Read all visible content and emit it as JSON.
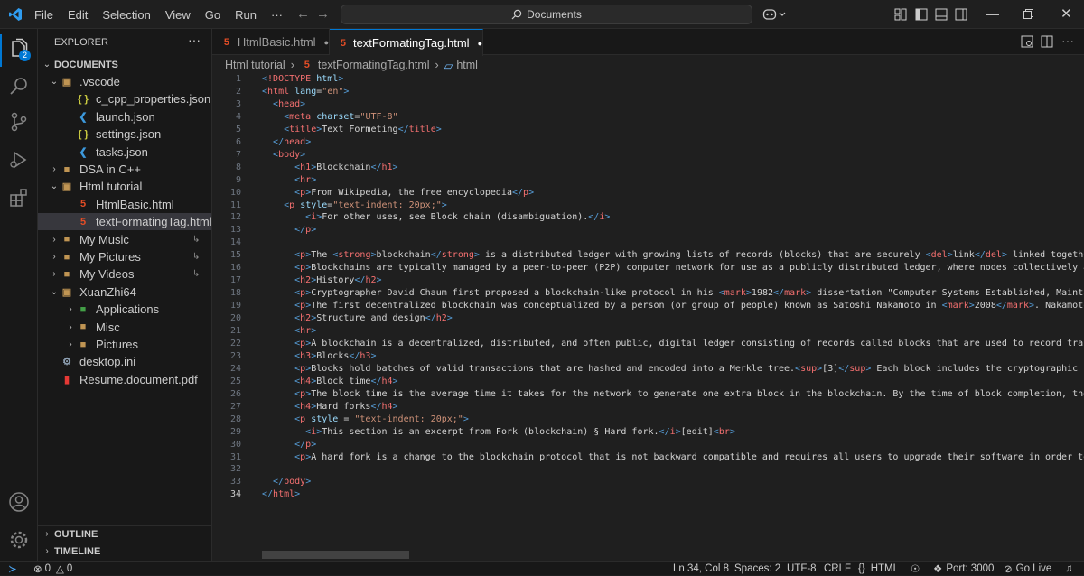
{
  "menu": [
    "File",
    "Edit",
    "Selection",
    "View",
    "Go",
    "Run",
    "···"
  ],
  "search": {
    "label": "Documents"
  },
  "activity": {
    "badge": "2"
  },
  "explorer": {
    "title": "EXPLORER",
    "root": "DOCUMENTS",
    "items": [
      {
        "label": ".vscode",
        "indent": 1,
        "type": "folder-open",
        "icon": "vscode-folder-icon"
      },
      {
        "label": "c_cpp_properties.json",
        "indent": 2,
        "type": "json"
      },
      {
        "label": "launch.json",
        "indent": 2,
        "type": "vscode"
      },
      {
        "label": "settings.json",
        "indent": 2,
        "type": "json"
      },
      {
        "label": "tasks.json",
        "indent": 2,
        "type": "vscode"
      },
      {
        "label": "DSA in C++",
        "indent": 1,
        "type": "folder-closed"
      },
      {
        "label": "Html tutorial",
        "indent": 1,
        "type": "folder-open"
      },
      {
        "label": "HtmlBasic.html",
        "indent": 2,
        "type": "html"
      },
      {
        "label": "textFormatingTag.html",
        "indent": 2,
        "type": "html",
        "selected": true
      },
      {
        "label": "My Music",
        "indent": 1,
        "type": "folder-link"
      },
      {
        "label": "My Pictures",
        "indent": 1,
        "type": "folder-link"
      },
      {
        "label": "My Videos",
        "indent": 1,
        "type": "folder-link"
      },
      {
        "label": "XuanZhi64",
        "indent": 1,
        "type": "folder-open"
      },
      {
        "label": "Applications",
        "indent": 2,
        "type": "folder-app"
      },
      {
        "label": "Misc",
        "indent": 2,
        "type": "folder-closed"
      },
      {
        "label": "Pictures",
        "indent": 2,
        "type": "folder-closed"
      },
      {
        "label": "desktop.ini",
        "indent": 1,
        "type": "gear"
      },
      {
        "label": "Resume.document.pdf",
        "indent": 1,
        "type": "pdf"
      }
    ],
    "outline": "OUTLINE",
    "timeline": "TIMELINE"
  },
  "tabs": [
    {
      "label": "HtmlBasic.html",
      "active": false
    },
    {
      "label": "textFormatingTag.html",
      "active": true
    }
  ],
  "breadcrumb": {
    "folder": "Html tutorial",
    "file": "textFormatingTag.html",
    "symbol": "html"
  },
  "code": [
    "<!DOCTYPE html>",
    "<html lang=\"en\">",
    "  <head>",
    "    <meta charset=\"UTF-8\"",
    "    <title>Text Formeting</title>",
    "  </head>",
    "  <body>",
    "      <h1>Blockchain</h1>",
    "      <hr>",
    "      <p>From Wikipedia, the free encyclopedia</p>",
    "    <p style=\"text-indent: 20px;\">",
    "        <i>For other uses, see Block chain (disambiguation).</i>",
    "      </p>",
    "",
    "      <p>The <strong>blockchain</strong> is a distributed ledger with growing lists of records (blocks) that are securely <del>link</del> linked together via c",
    "      <p>Blockchains are typically managed by a peer-to-peer (P2P) computer network for use as a publicly distributed ledger, where nodes collectively adhere to",
    "      <h2>History</h2>",
    "      <p>Cryptographer David Chaum first proposed a blockchain-like protocol in his <mark>1982</mark> dissertation \"Computer Systems Established, Maintained,",
    "      <p>The first decentralized blockchain was conceptualized by a person (or group of people) known as Satoshi Nakamoto in <mark>2008</mark>. Nakamoto improv",
    "      <h2>Structure and design</h2>",
    "      <hr>",
    "      <p>A blockchain is a decentralized, distributed, and often public, digital ledger consisting of records called blocks that are used to record transaction",
    "      <h3>Blocks</h3>",
    "      <p>Blocks hold batches of valid transactions that are hashed and encoded into a Merkle tree.<sup>[3]</sup> Each block includes the cryptographic hash of",
    "      <h4>Block time</h4>",
    "      <p>The block time is the average time it takes for the network to generate one extra block in the blockchain. By the time of block completion, the inclu",
    "      <h4>Hard forks</h4>",
    "      <p style = \"text-indent: 20px;\">",
    "        <i>This section is an excerpt from Fork (blockchain) § Hard fork.</i>[edit]<br>",
    "      </p>",
    "      <p>A hard fork is a change to the blockchain protocol that is not backward compatible and requires all users to upgrade their software in order to conti",
    "",
    "  </body>",
    "</html>"
  ],
  "current_line": 34,
  "status": {
    "errors": "0",
    "warnings": "0",
    "position": "Ln 34, Col 8",
    "spaces": "Spaces: 2",
    "encoding": "UTF-8",
    "eol": "CRLF",
    "language": "HTML",
    "port": "Port: 3000",
    "golive": "Go Live"
  },
  "colors": {
    "accent": "#0078d4",
    "html_icon": "#e44d26",
    "json_icon": "#cbcb41",
    "vscode_icon": "#3c99dc",
    "folder": "#c09553"
  }
}
